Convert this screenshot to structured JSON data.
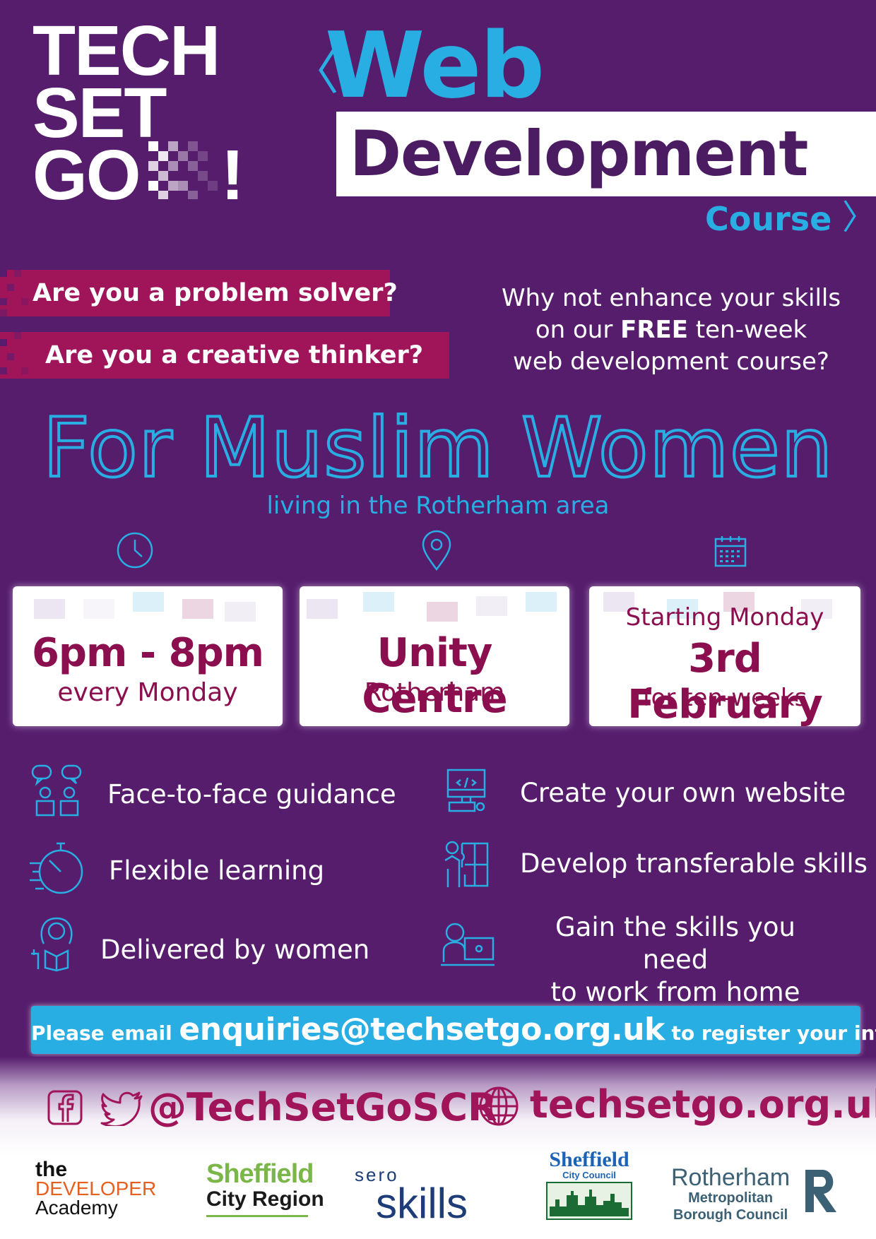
{
  "logo": {
    "line1": "TECH",
    "line2": "SET",
    "line3": "GO",
    "exclaim": "!"
  },
  "title": {
    "left_chevron": "〈",
    "right_chevron": "〉",
    "web": "Web",
    "development": "Development",
    "course": "Course"
  },
  "questions": [
    "Are you a problem solver?",
    "Are you a creative thinker?"
  ],
  "intro": {
    "line1": "Why not enhance your skills",
    "line2_pre": "on our ",
    "line2_bold": "FREE",
    "line2_post": " ten-week",
    "line3": "web development course?"
  },
  "audience": {
    "heading": "For Muslim Women",
    "subheading": "living in the Rotherham area"
  },
  "icons": [
    "clock-icon",
    "location-pin-icon",
    "calendar-icon"
  ],
  "cards": {
    "time": {
      "main": "6pm - 8pm",
      "sub": "every Monday"
    },
    "place": {
      "main": "Unity Centre",
      "sub": "Rotherham"
    },
    "date": {
      "top": "Starting Monday",
      "main": "3rd February",
      "sub": "for ten-weeks"
    }
  },
  "features": [
    {
      "icon": "speech-bubbles-people-icon",
      "text": "Face-to-face guidance"
    },
    {
      "icon": "code-computer-icon",
      "text": "Create your own website"
    },
    {
      "icon": "stopwatch-icon",
      "text": "Flexible learning"
    },
    {
      "icon": "puzzle-person-icon",
      "text": "Develop transferable skills"
    },
    {
      "icon": "woman-reading-icon",
      "text": "Delivered by women"
    },
    {
      "icon": "person-at-computer-icon",
      "text_line1": "Gain the skills you need",
      "text_line2": "to work from home"
    }
  ],
  "cta": {
    "pre": "Please email ",
    "email": "enquiries@techsetgo.org.uk",
    "post": " to register your interest"
  },
  "social": {
    "handle": "@TechSetGoSCR",
    "website": "techsetgo.org.uk"
  },
  "partners": {
    "developer_academy": {
      "line1": "the",
      "line2": "DEVELOPER",
      "line3": "Academy"
    },
    "sheffield_city_region": {
      "line1": "Sheffield",
      "line2": "City Region"
    },
    "sero_skills": {
      "line1": "sero",
      "line2": "skills"
    },
    "sheffield_city_council": {
      "line1": "Sheffield",
      "line2": "City Council"
    },
    "rotherham": {
      "line1": "Rotherham",
      "line2": "Metropolitan",
      "line3": "Borough Council"
    }
  },
  "colors": {
    "background": "#561d6d",
    "accent_blue": "#29aee3",
    "accent_magenta": "#a0145a",
    "card_text": "#8b0f4f"
  }
}
